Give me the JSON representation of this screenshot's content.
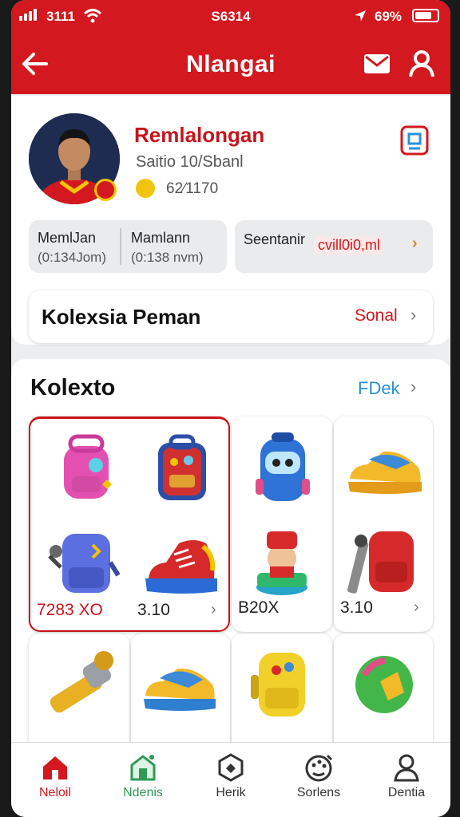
{
  "status_bar": {
    "left": "3111",
    "center": "S6314",
    "right": "69%"
  },
  "header": {
    "title": "Nlangai"
  },
  "profile": {
    "name": "Remlalongan",
    "subtitle": "Saitio 10/Sbanl",
    "value": "62⁄1170"
  },
  "stats": [
    {
      "label": "MemlJan",
      "value": "(0:134Jom)"
    },
    {
      "label": "Mamlann",
      "value": "(0:138 nvm)"
    }
  ],
  "promo": {
    "label": "Seentanir",
    "highlight": "cvill0i0,ml"
  },
  "kolexsia": {
    "title": "Kolexsia Peman",
    "more": "Sonal"
  },
  "collection": {
    "title": "Kolexto",
    "more": "FDek",
    "prices": [
      "7283 XO",
      "3.10",
      "B20X",
      "3.10"
    ]
  },
  "colors": {
    "brand_red": "#d3181f",
    "link_blue": "#2a8fd6",
    "accent_orange": "#e67e22"
  },
  "tabs": [
    {
      "label": "Neloil",
      "icon": "home-icon",
      "color": "#d3181f"
    },
    {
      "label": "Ndenis",
      "icon": "store-icon",
      "color": "#2e9a55"
    },
    {
      "label": "Herik",
      "icon": "hexagon-icon",
      "color": "#333333"
    },
    {
      "label": "Sorlens",
      "icon": "palette-icon",
      "color": "#333333"
    },
    {
      "label": "Dentia",
      "icon": "person-icon",
      "color": "#333333"
    }
  ]
}
